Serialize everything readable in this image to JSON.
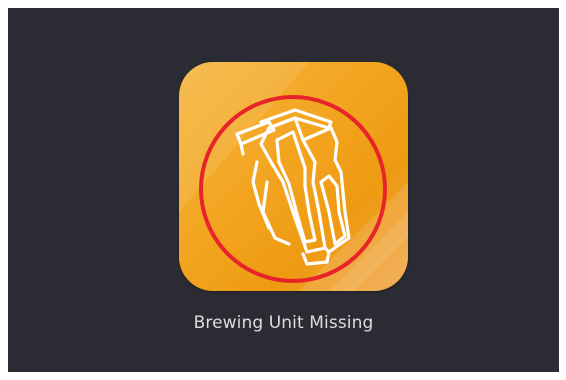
{
  "screen": {
    "icon": "brewing-unit-missing-icon",
    "tile_color": "#f3a41f",
    "alert_ring_color": "#e8232a",
    "message": "Brewing Unit Missing"
  }
}
